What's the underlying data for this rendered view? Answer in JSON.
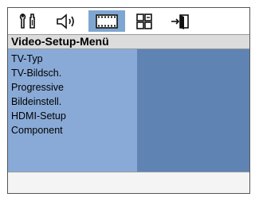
{
  "tabs": [
    {
      "icon": "settings-icon",
      "active": false
    },
    {
      "icon": "speaker-icon",
      "active": false
    },
    {
      "icon": "video-screen-icon",
      "active": true
    },
    {
      "icon": "preferences-grid-icon",
      "active": false
    },
    {
      "icon": "exit-icon",
      "active": false
    }
  ],
  "menu": {
    "title": "Video-Setup-Menü",
    "items": [
      "TV-Typ",
      "TV-Bildsch.",
      "Progressive",
      "Bildeinstell.",
      "HDMI-Setup",
      "Component"
    ]
  },
  "colors": {
    "active_tab": "#7fa6d0",
    "menu_panel": "#89aad6",
    "options_panel": "#5f84b4",
    "title_bar": "#dcdcdc"
  }
}
